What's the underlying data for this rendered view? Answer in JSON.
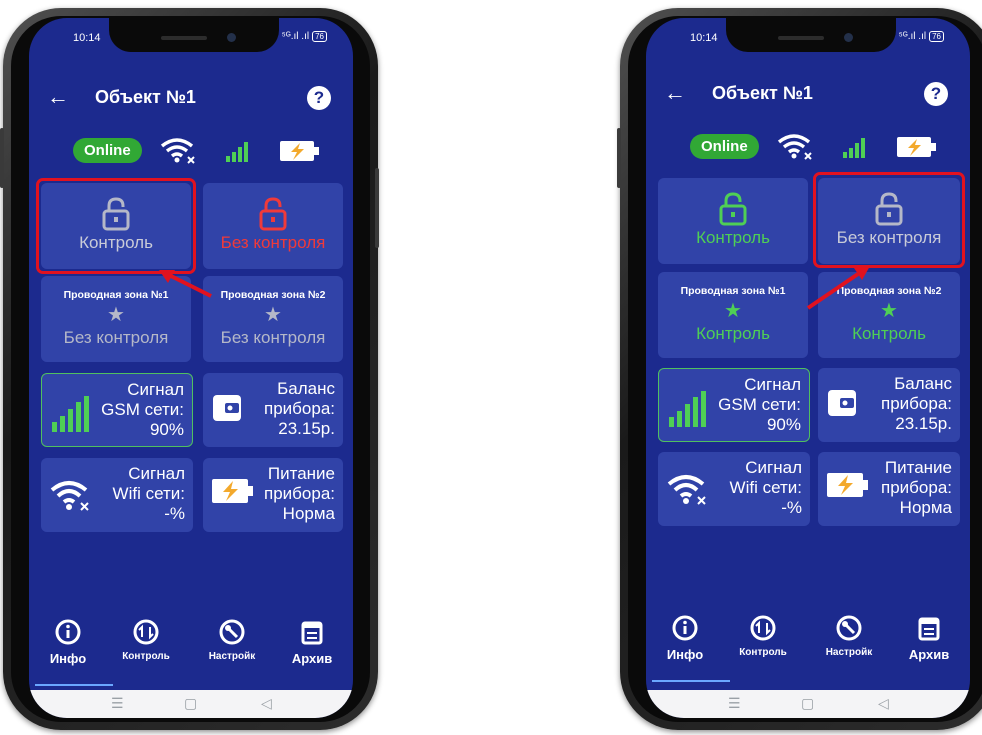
{
  "status": {
    "time": "10:14",
    "indicators": "⁵ᴳ.ıl .ıl",
    "battery": "76"
  },
  "header": {
    "back_icon": "arrow-left",
    "title": "Объект №1",
    "help_label": "?"
  },
  "connection": {
    "online_label": "Online",
    "icons": [
      "wifi-off-icon",
      "gsm-signal-icon",
      "battery-charging-icon"
    ]
  },
  "colors": {
    "background": "#1c2a8e",
    "tile": "#3143a8",
    "online": "#31a835",
    "green": "#4fcf55",
    "red": "#f03a3a",
    "grey": "#b5b8c8",
    "highlight": "#e1121f"
  },
  "left": {
    "lock_control": {
      "label": "Контроль"
    },
    "lock_no_control": {
      "label": "Без контроля"
    },
    "zone1": {
      "title": "Проводная зона №1",
      "status": "Без контроля"
    },
    "zone2": {
      "title": "Проводная зона №2",
      "status": "Без контроля"
    }
  },
  "right": {
    "lock_control": {
      "label": "Контроль"
    },
    "lock_no_control": {
      "label": "Без контроля"
    },
    "zone1": {
      "title": "Проводная зона №1",
      "status": "Контроль"
    },
    "zone2": {
      "title": "Проводная зона №2",
      "status": "Контроль"
    }
  },
  "info": {
    "gsm": [
      "Сигнал",
      "GSM сети:",
      "90%"
    ],
    "balance": [
      "Баланс",
      "прибора:",
      "23.15р."
    ],
    "wifi": [
      "Сигнал",
      "Wifi сети:",
      "-%"
    ],
    "power": [
      "Питание",
      "прибора:",
      "Норма"
    ]
  },
  "nav": [
    {
      "label": "Инфо",
      "icon": "info-icon"
    },
    {
      "label": "Контроль",
      "icon": "arrows-swap-icon"
    },
    {
      "label": "Настройк",
      "icon": "wrench-icon"
    },
    {
      "label": "Архив",
      "icon": "calendar-icon"
    }
  ],
  "sys_nav": {
    "menu": "☰",
    "home": "▢",
    "back": "◁"
  }
}
